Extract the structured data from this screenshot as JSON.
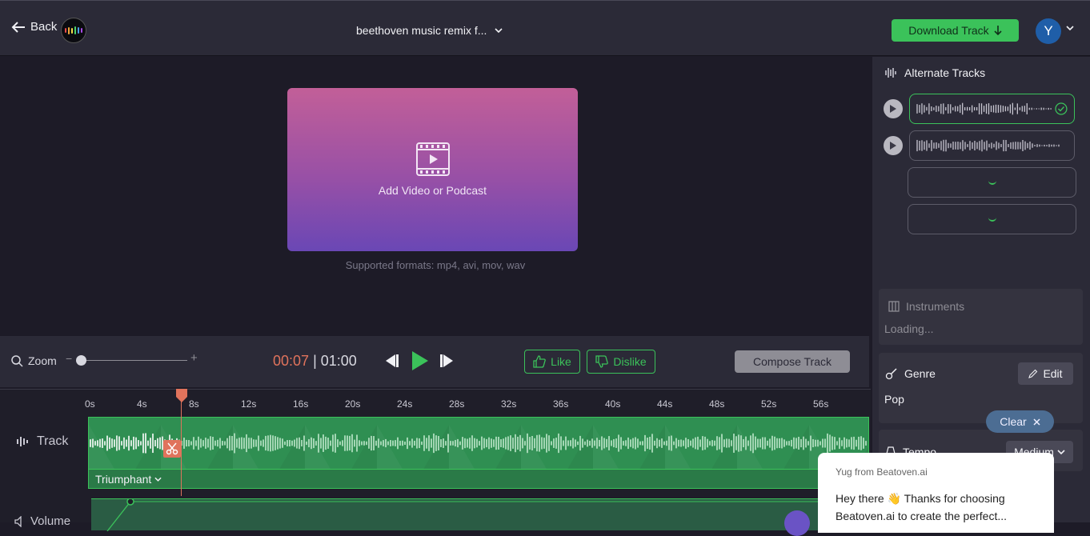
{
  "header": {
    "back_label": "Back",
    "project_title": "beethoven music remix f...",
    "download_label": "Download Track",
    "avatar_initial": "Y"
  },
  "upload": {
    "label": "Add Video or Podcast",
    "formats": "Supported formats: mp4, avi, mov, wav"
  },
  "controls": {
    "zoom_label": "Zoom",
    "zoom_minus": "−",
    "zoom_plus": "+",
    "zoom_level": 0,
    "time_current": "00:07",
    "time_separator": "|",
    "time_total": "01:00",
    "like_label": "Like",
    "dislike_label": "Dislike",
    "compose_label": "Compose Track"
  },
  "timeline": {
    "ticks": [
      "0s",
      "4s",
      "8s",
      "12s",
      "16s",
      "20s",
      "24s",
      "28s",
      "32s",
      "36s",
      "40s",
      "44s",
      "48s",
      "52s",
      "56s"
    ],
    "track_label": "Track",
    "mood_label": "Triumphant",
    "volume_label": "Volume"
  },
  "right_panel": {
    "alternate_tracks_title": "Alternate Tracks",
    "instruments_title": "Instruments",
    "instruments_status": "Loading...",
    "genre_title": "Genre",
    "genre_value": "Pop",
    "edit_label": "Edit",
    "tempo_title": "Tempo",
    "tempo_value": "Medium",
    "clear_label": "Clear"
  },
  "chat": {
    "from": "Yug from Beatoven.ai",
    "message": "Hey there 👋 Thanks for choosing Beatoven.ai to create the perfect..."
  },
  "colors": {
    "accent_green": "#3bc25a",
    "playhead": "#e0735c",
    "panel_bg": "#2b2a37",
    "page_bg": "#1d1b27"
  }
}
